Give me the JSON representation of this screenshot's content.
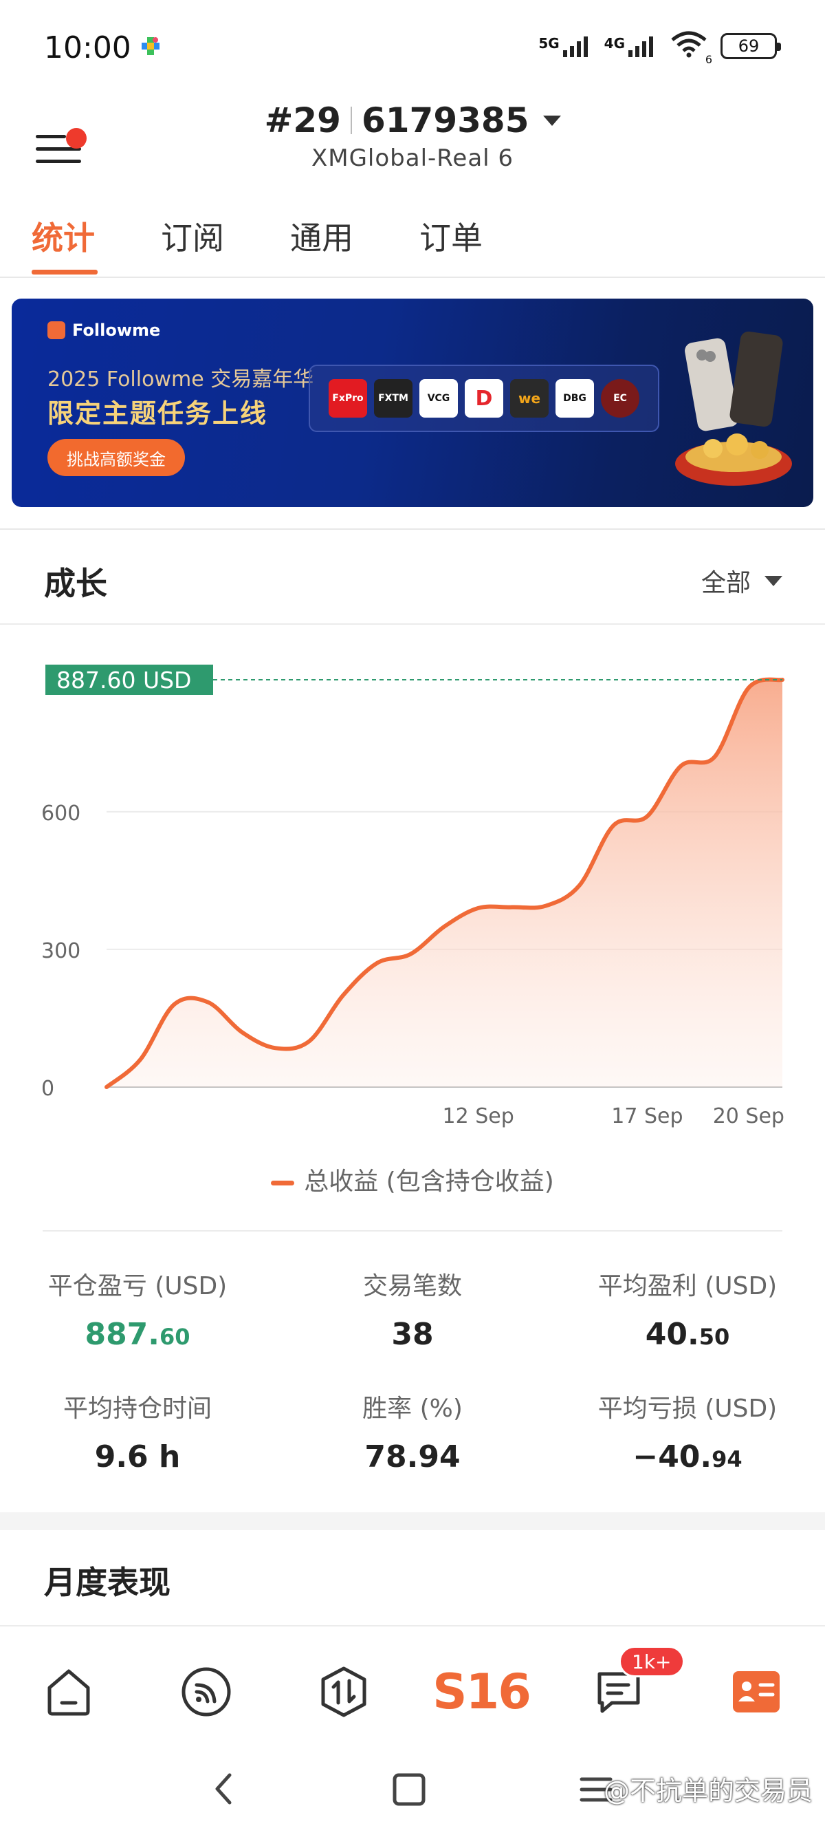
{
  "status_bar": {
    "time": "10:00",
    "net1": "5G",
    "net2": "4G",
    "wifi_sub": "6",
    "battery": "69"
  },
  "header": {
    "rank": "#29",
    "account_id": "6179385",
    "server": "XMGlobal-Real 6"
  },
  "tabs": [
    {
      "label": "统计",
      "active": true
    },
    {
      "label": "订阅",
      "active": false
    },
    {
      "label": "通用",
      "active": false
    },
    {
      "label": "订单",
      "active": false
    }
  ],
  "banner": {
    "brand": "Followme",
    "subtitle": "2025 Followme 交易嘉年华",
    "title": "限定主题任务上线",
    "button": "挑战高额奖金",
    "partners": [
      "FxPro",
      "FXTM",
      "VCG",
      "D",
      "we",
      "DBG",
      "EC"
    ]
  },
  "growth": {
    "title": "成长",
    "range": "全部"
  },
  "chart_data": {
    "type": "area",
    "x": [
      "",
      "",
      "",
      "",
      "",
      "",
      "",
      "",
      "",
      "",
      "",
      "12 Sep",
      "",
      "",
      "",
      "",
      "17 Sep",
      "",
      "",
      "20 Sep",
      ""
    ],
    "x_ticks": [
      "12 Sep",
      "17 Sep",
      "20 Sep"
    ],
    "y_ticks": [
      "0",
      "300",
      "600"
    ],
    "ylim": [
      0,
      887.6
    ],
    "current_label": "887.60 USD",
    "series": [
      {
        "name": "总收益 (包含持仓收益)",
        "color": "#f06a37",
        "values": [
          0,
          60,
          180,
          185,
          120,
          85,
          100,
          200,
          270,
          290,
          350,
          390,
          392,
          395,
          440,
          570,
          590,
          700,
          720,
          870,
          887.6
        ]
      }
    ]
  },
  "legend": {
    "label": "总收益 (包含持仓收益)"
  },
  "stats": [
    {
      "label": "平仓盈亏 (USD)",
      "value_main": "887.",
      "value_small": "60",
      "color": "green"
    },
    {
      "label": "交易笔数",
      "value_main": "38",
      "value_small": ""
    },
    {
      "label": "平均盈利 (USD)",
      "value_main": "40.",
      "value_small": "50"
    },
    {
      "label": "平均持仓时间",
      "value_main": "9.6 h",
      "value_small": ""
    },
    {
      "label": "胜率 (%)",
      "value_main": "78.94",
      "value_small": ""
    },
    {
      "label": "平均亏损 (USD)",
      "value_main": "−40.",
      "value_small": "94"
    }
  ],
  "monthly": {
    "title": "月度表现"
  },
  "bottom_nav": {
    "center_label": "S16",
    "messages_badge": "1k+"
  },
  "watermark": "@不抗单的交易员"
}
